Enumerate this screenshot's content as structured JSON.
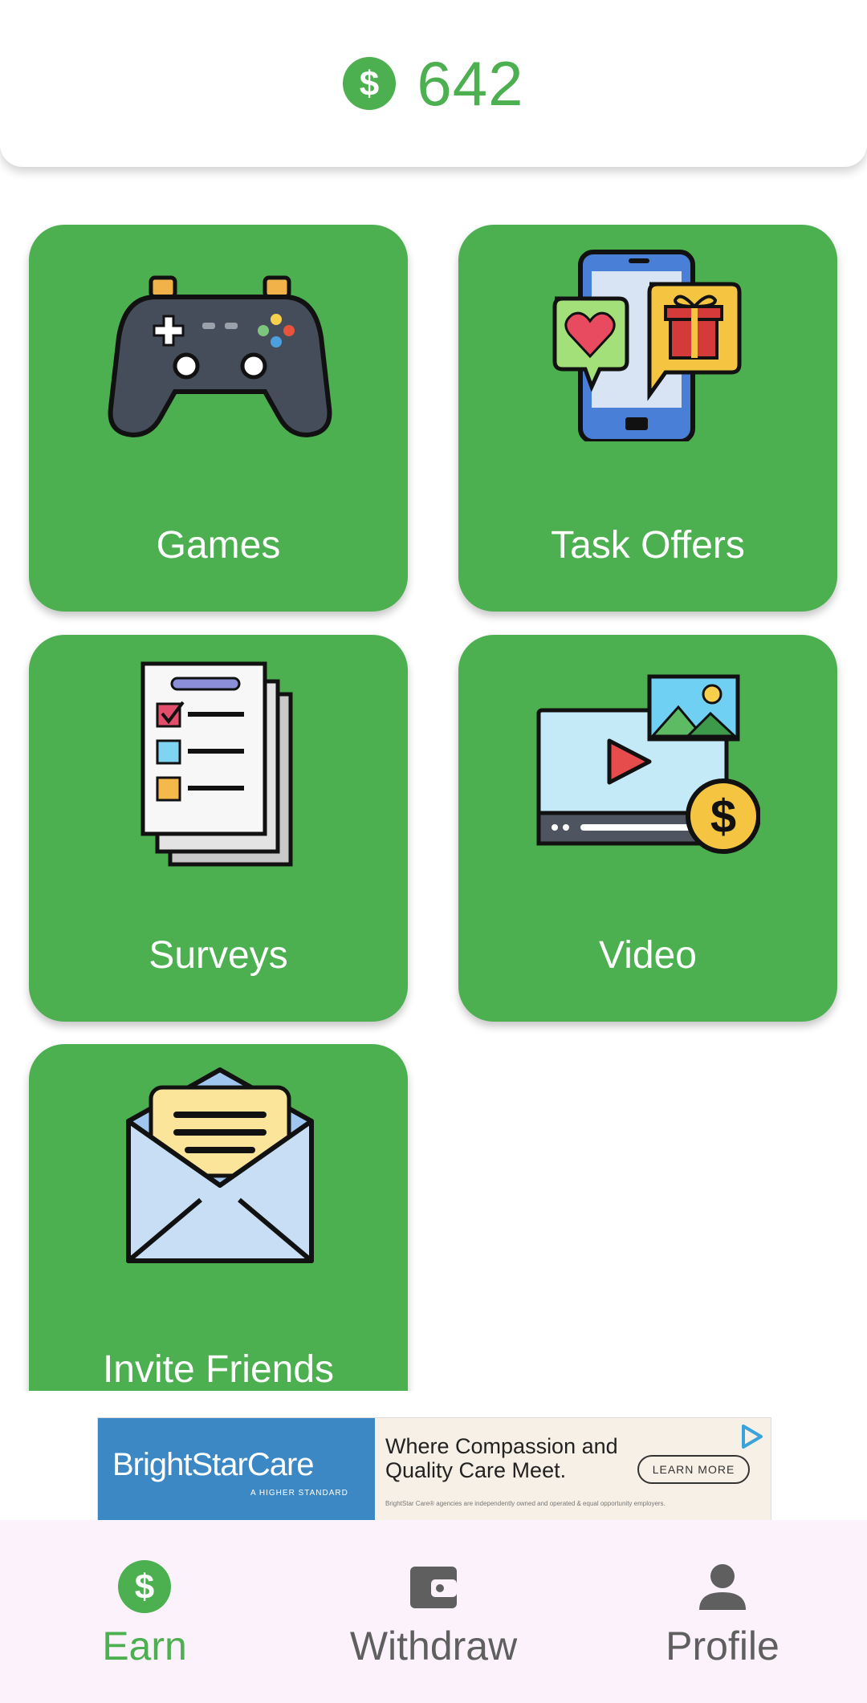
{
  "header": {
    "balance": "642",
    "icon": "dollar-coin-icon"
  },
  "tiles": [
    {
      "label": "Games",
      "icon": "gamepad-icon"
    },
    {
      "label": "Task Offers",
      "icon": "phone-gift-icon"
    },
    {
      "label": "Surveys",
      "icon": "survey-checklist-icon"
    },
    {
      "label": "Video",
      "icon": "video-earn-icon"
    },
    {
      "label": "Invite Friends",
      "icon": "envelope-invite-icon"
    }
  ],
  "ad": {
    "brand": "BrightStarCare",
    "tagline": "A HIGHER STANDARD",
    "headline": "Where Compassion and Quality Care Meet.",
    "button": "LEARN MORE",
    "disclaimer": "BrightStar Care® agencies are independently owned and operated & equal opportunity employers."
  },
  "nav": [
    {
      "label": "Earn",
      "icon": "dollar-coin-icon",
      "active": true
    },
    {
      "label": "Withdraw",
      "icon": "wallet-icon",
      "active": false
    },
    {
      "label": "Profile",
      "icon": "person-icon",
      "active": false
    }
  ],
  "colors": {
    "accent": "#4CAF50",
    "inactive": "#5f5f5f",
    "navBg": "#fbf2fb"
  }
}
